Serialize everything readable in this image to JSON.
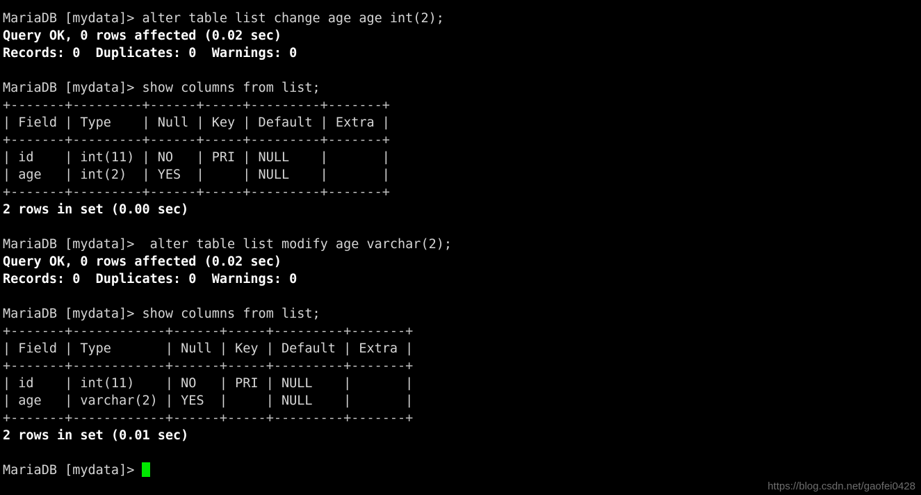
{
  "terminal": {
    "title": "MariaDB client session",
    "background_color": "#000000",
    "text_color": "#d6d6d6",
    "bold_text_color": "#ffffff",
    "cursor_color": "#00e800",
    "lines": [
      {
        "text": "MariaDB [mydata]> alter table list change age age int(2);",
        "style": "normal"
      },
      {
        "text": "Query OK, 0 rows affected (0.02 sec)",
        "style": "bold"
      },
      {
        "text": "Records: 0  Duplicates: 0  Warnings: 0",
        "style": "bold"
      },
      {
        "text": "",
        "style": "blank"
      },
      {
        "text": "MariaDB [mydata]> show columns from list;",
        "style": "normal"
      },
      {
        "text": "+-------+---------+------+-----+---------+-------+",
        "style": "border"
      },
      {
        "text": "| Field | Type    | Null | Key | Default | Extra |",
        "style": "normal"
      },
      {
        "text": "+-------+---------+------+-----+---------+-------+",
        "style": "border"
      },
      {
        "text": "| id    | int(11) | NO   | PRI | NULL    |       |",
        "style": "normal"
      },
      {
        "text": "| age   | int(2)  | YES  |     | NULL    |       |",
        "style": "normal"
      },
      {
        "text": "+-------+---------+------+-----+---------+-------+",
        "style": "border"
      },
      {
        "text": "2 rows in set (0.00 sec)",
        "style": "bold"
      },
      {
        "text": "",
        "style": "blank"
      },
      {
        "text": "MariaDB [mydata]>  alter table list modify age varchar(2);",
        "style": "normal"
      },
      {
        "text": "Query OK, 0 rows affected (0.02 sec)",
        "style": "bold"
      },
      {
        "text": "Records: 0  Duplicates: 0  Warnings: 0",
        "style": "bold"
      },
      {
        "text": "",
        "style": "blank"
      },
      {
        "text": "MariaDB [mydata]> show columns from list;",
        "style": "normal"
      },
      {
        "text": "+-------+------------+------+-----+---------+-------+",
        "style": "border"
      },
      {
        "text": "| Field | Type       | Null | Key | Default | Extra |",
        "style": "normal"
      },
      {
        "text": "+-------+------------+------+-----+---------+-------+",
        "style": "border"
      },
      {
        "text": "| id    | int(11)    | NO   | PRI | NULL    |       |",
        "style": "normal"
      },
      {
        "text": "| age   | varchar(2) | YES  |     | NULL    |       |",
        "style": "normal"
      },
      {
        "text": "+-------+------------+------+-----+---------+-------+",
        "style": "border"
      },
      {
        "text": "2 rows in set (0.01 sec)",
        "style": "bold"
      },
      {
        "text": "",
        "style": "blank"
      }
    ],
    "final_prompt": "MariaDB [mydata]> ",
    "commands": [
      "alter table list change age age int(2);",
      "show columns from list;",
      " alter table list modify age varchar(2);",
      "show columns from list;"
    ],
    "tables": [
      {
        "headers": [
          "Field",
          "Type",
          "Null",
          "Key",
          "Default",
          "Extra"
        ],
        "rows": [
          [
            "id",
            "int(11)",
            "NO",
            "PRI",
            "NULL",
            ""
          ],
          [
            "age",
            "int(2)",
            "YES",
            "",
            "NULL",
            ""
          ]
        ],
        "result_status": "2 rows in set (0.00 sec)"
      },
      {
        "headers": [
          "Field",
          "Type",
          "Null",
          "Key",
          "Default",
          "Extra"
        ],
        "rows": [
          [
            "id",
            "int(11)",
            "NO",
            "PRI",
            "NULL",
            ""
          ],
          [
            "age",
            "varchar(2)",
            "YES",
            "",
            "NULL",
            ""
          ]
        ],
        "result_status": "2 rows in set (0.01 sec)"
      }
    ],
    "query_results": [
      {
        "status": "Query OK, 0 rows affected (0.02 sec)",
        "counters": "Records: 0  Duplicates: 0  Warnings: 0"
      },
      {
        "status": "Query OK, 0 rows affected (0.02 sec)",
        "counters": "Records: 0  Duplicates: 0  Warnings: 0"
      }
    ]
  },
  "watermark": {
    "text": "https://blog.csdn.net/gaofei0428",
    "color": "#6e6e6e"
  }
}
